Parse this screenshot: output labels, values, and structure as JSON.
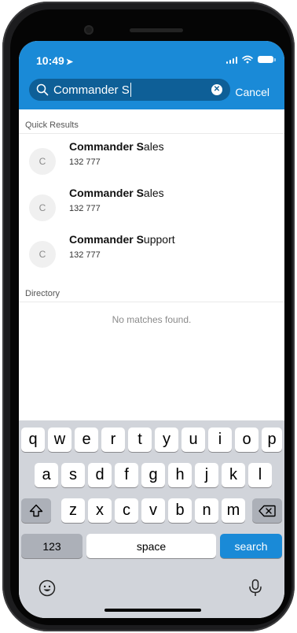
{
  "status": {
    "time": "10:49",
    "location_icon": "location-arrow-icon"
  },
  "search": {
    "query": "Commander S",
    "cancel_label": "Cancel"
  },
  "sections": {
    "quick_results": "Quick Results",
    "directory": "Directory"
  },
  "results": [
    {
      "avatar": "C",
      "name_match": "Commander S",
      "name_rest": "ales",
      "number": "132 777"
    },
    {
      "avatar": "C",
      "name_match": "Commander S",
      "name_rest": "ales",
      "number": "132 777"
    },
    {
      "avatar": "C",
      "name_match": "Commander S",
      "name_rest": "upport",
      "number": "132 777"
    }
  ],
  "directory": {
    "empty_message": "No matches found."
  },
  "keyboard": {
    "row1": [
      "q",
      "w",
      "e",
      "r",
      "t",
      "y",
      "u",
      "i",
      "o",
      "p"
    ],
    "row2": [
      "a",
      "s",
      "d",
      "f",
      "g",
      "h",
      "j",
      "k",
      "l"
    ],
    "row3": [
      "z",
      "x",
      "c",
      "v",
      "b",
      "n",
      "m"
    ],
    "numbers_label": "123",
    "space_label": "space",
    "search_label": "search"
  },
  "colors": {
    "accent": "#1a8ad7",
    "search_field": "#0e5f97"
  }
}
